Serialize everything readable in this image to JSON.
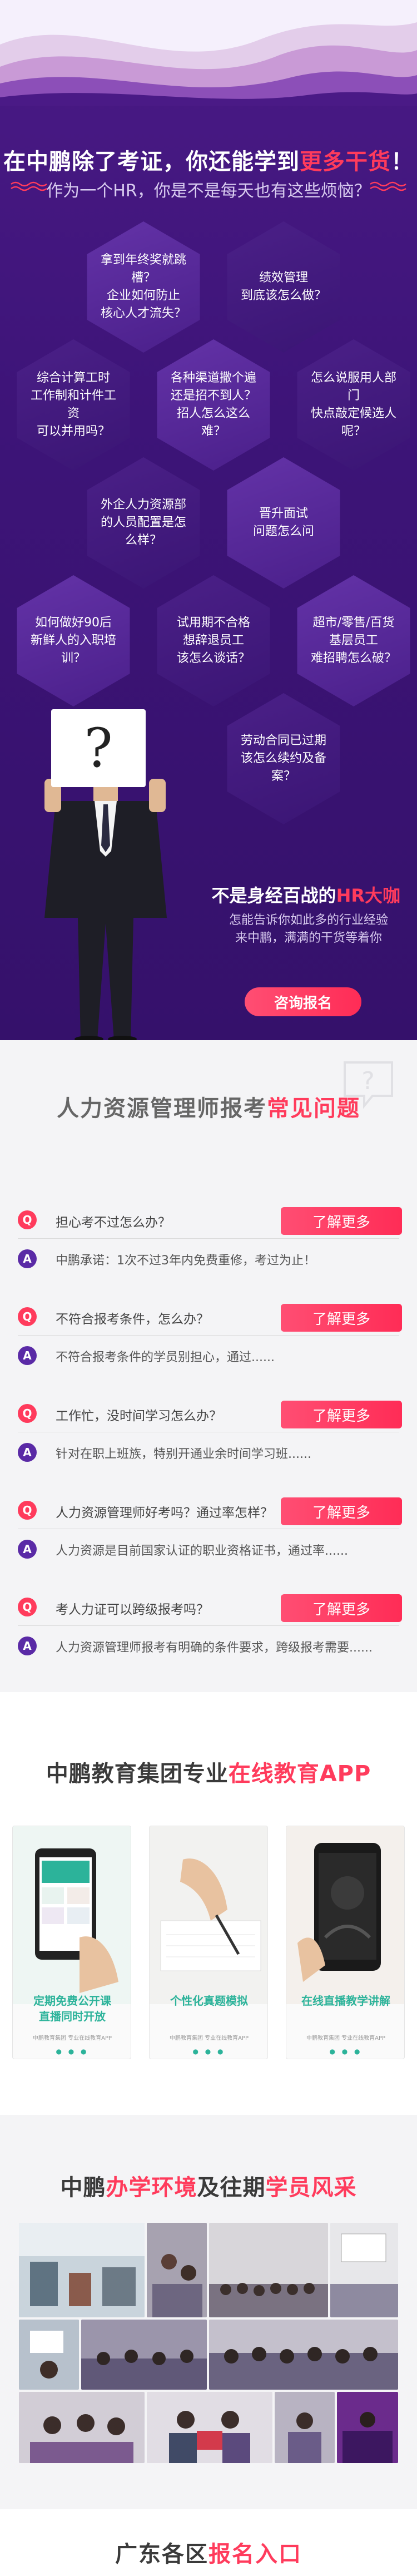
{
  "hero": {
    "headline_a": "在中鹏除了考证，你还能学到",
    "headline_b": "更多干货",
    "headline_c": "！",
    "subtitle": "作为一个HR，你是不是每天也有这些烦恼？",
    "hexes": [
      "拿到年终奖就跳槽？\n企业如何防止\n核心人才流失？",
      "绩效管理\n到底该怎么做？",
      "综合计算工时\n工作制和计件工资\n可以并用吗？",
      "各种渠道撒个遍\n还是招不到人？\n招人怎么这么难？",
      "怎么说服用人部门\n快点敲定候选人呢？",
      "外企人力资源部\n的人员配置是怎么样？",
      "晋升面试\n问题怎么问",
      "如何做好90后\n新鲜人的入职培训？",
      "试用期不合格\n想辞退员工\n该怎么谈话？",
      "超市/零售/百货\n基层员工\n难招聘怎么破？",
      "劳动合同已过期\n该怎么续约及备案？"
    ],
    "paper_glyph": "?",
    "promo_title_a": "不是身经百战的",
    "promo_title_b": "HR大咖",
    "promo_desc": "怎能告诉你如此多的行业经验\n来中鹏，满满的干货等着你",
    "consult_label": "咨询报名"
  },
  "faq": {
    "title_a": "人力资源管理师报考",
    "title_b": "常见问题",
    "q_badge": "Q",
    "a_badge": "A",
    "more_label": "了解更多",
    "items": [
      {
        "q": "担心考不过怎么办？",
        "a": "中鹏承诺：1次不过3年内免费重修，考过为止！"
      },
      {
        "q": "不符合报考条件，怎么办？",
        "a": "不符合报考条件的学员别担心，通过......"
      },
      {
        "q": "工作忙，没时间学习怎么办？",
        "a": "针对在职上班族，特别开通业余时间学习班......"
      },
      {
        "q": "人力资源管理师好考吗？通过率怎样？",
        "a": "人力资源是目前国家认证的职业资格证书，通过率......"
      },
      {
        "q": "考人力证可以跨级报考吗？",
        "a": "人力资源管理师报考有明确的条件要求，跨级报考需要......"
      }
    ]
  },
  "app": {
    "title_a": "中鹏教育集团专业",
    "title_b": "在线教育APP",
    "cards": [
      {
        "caption": "定期免费公开课\n直播同时开放",
        "foot": "中鹏教育集团 专业在线教育APP"
      },
      {
        "caption": "个性化真题模拟",
        "foot": "中鹏教育集团 专业在线教育APP"
      },
      {
        "caption": "在线直播教学讲解",
        "foot": "中鹏教育集团 专业在线教育APP"
      }
    ],
    "dots": "● ● ●"
  },
  "env": {
    "title_a": "中鹏",
    "title_b": "办学环境",
    "title_c": "及往期",
    "title_d": "学员风采"
  },
  "region": {
    "title_a": "广东各区",
    "title_b": "报名入口"
  },
  "colors": {
    "accent": "#ff3b5c",
    "purple": "#4a1a86",
    "teal": "#2cb39a"
  }
}
